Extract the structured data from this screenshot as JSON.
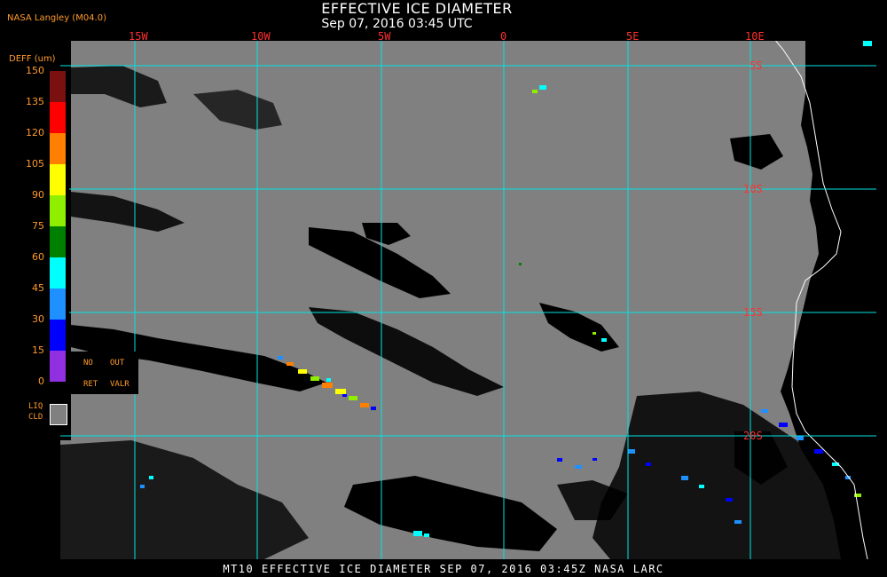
{
  "header": {
    "title": "EFFECTIVE ICE DIAMETER",
    "subtitle": "Sep 07, 2016 03:45 UTC",
    "producer": "NASA Langley (M04.0)"
  },
  "map": {
    "lon_labels": [
      "15W",
      "10W",
      "5W",
      "0",
      "5E",
      "10E"
    ],
    "lat_labels": [
      "5S",
      "10S",
      "15S",
      "20S"
    ],
    "colors": {
      "background": "#000000",
      "no_cloud": "#000000",
      "liquid_cloud": "#808080",
      "grid": "#00e5e5",
      "grid_labels": "#ff3030",
      "coastline": "#ffffff"
    }
  },
  "legend": {
    "title": "DEFF (um)",
    "ticks": [
      "150",
      "135",
      "120",
      "105",
      "90",
      "75",
      "60",
      "45",
      "30",
      "15",
      "0"
    ],
    "colors": [
      "#7a1010",
      "#ff0000",
      "#ff8000",
      "#ffff00",
      "#90ee00",
      "#008000",
      "#00ffff",
      "#1e90ff",
      "#0000ff",
      "#9030e0"
    ],
    "no_ret_line1": "NO",
    "no_ret_line2": "RET",
    "out_valr_line1": "OUT",
    "out_valr_line2": "VALR",
    "liq_cld_line1": "LIQ",
    "liq_cld_line2": "CLD",
    "liq_cld_color": "#808080"
  },
  "footer": {
    "text": "MT10  EFFECTIVE ICE DIAMETER   SEP 07, 2016 03:45Z   NASA LARC"
  }
}
